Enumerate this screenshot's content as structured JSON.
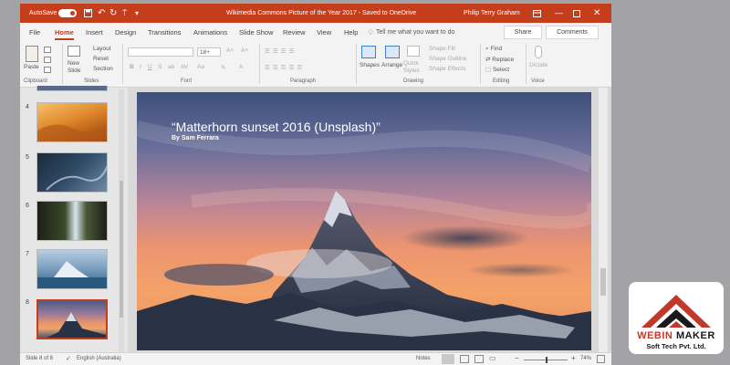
{
  "window": {
    "autosave_label": "AutoSave",
    "autosave_state": "on",
    "title": "Wikimedia Commons Picture of the Year 2017  -  Saved to OneDrive",
    "user": "Philip Terry Graham"
  },
  "tabs": [
    "File",
    "Home",
    "Insert",
    "Design",
    "Transitions",
    "Animations",
    "Slide Show",
    "Review",
    "View",
    "Help"
  ],
  "active_tab": "Home",
  "tell_me": "Tell me what you want to do",
  "share_label": "Share",
  "comments_label": "Comments",
  "ribbon": {
    "paste": "Paste",
    "new_slide": "New Slide",
    "layout": "Layout",
    "reset": "Reset",
    "section": "Section",
    "font_size": "18+",
    "shapes": "Shapes",
    "arrange": "Arrange",
    "quick_styles": "Quick Styles",
    "shape_fill": "Shape Fill",
    "shape_outline": "Shape Outline",
    "shape_effects": "Shape Effects",
    "find": "Find",
    "replace": "Replace",
    "select": "Select",
    "dictate": "Dictate",
    "groups": {
      "clipboard": "Clipboard",
      "slides": "Slides",
      "font": "Font",
      "paragraph": "Paragraph",
      "drawing": "Drawing",
      "editing": "Editing",
      "voice": "Voice"
    }
  },
  "thumbnails": [
    {
      "num": "4",
      "theme": "desert"
    },
    {
      "num": "5",
      "theme": "ocean-aerial"
    },
    {
      "num": "6",
      "theme": "waterfall"
    },
    {
      "num": "7",
      "theme": "iceberg"
    },
    {
      "num": "8",
      "theme": "matterhorn",
      "selected": true
    }
  ],
  "slide": {
    "title": "“Matterhorn sunset 2016 (Unsplash)”",
    "subtitle": "By Sam Ferrara"
  },
  "status": {
    "slide_position": "Slide 8 of 8",
    "language": "English (Australia)",
    "notes": "Notes",
    "zoom": "74%"
  },
  "logo": {
    "word_a": "WEBIN",
    "word_b": "MAKER",
    "tagline": "Soft Tech Pvt. Ltd.",
    "colors": {
      "red": "#c0392b",
      "dark": "#1a1a1a"
    }
  },
  "colors": {
    "accent": "#c43e1c"
  }
}
